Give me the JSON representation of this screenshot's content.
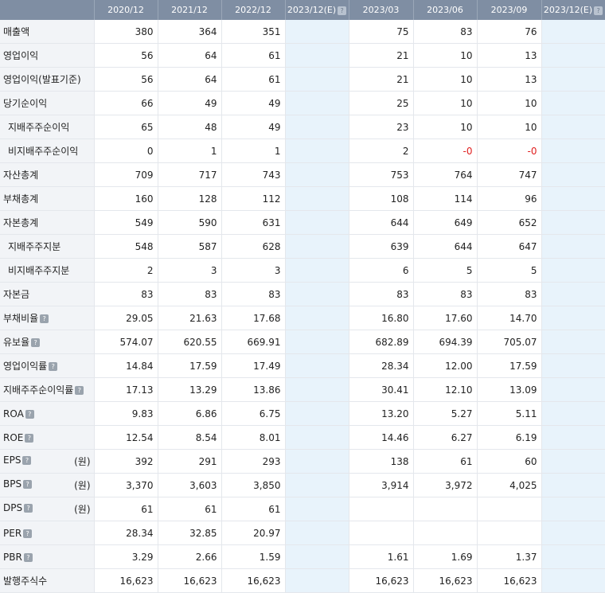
{
  "headers": [
    "",
    "2020/12",
    "2021/12",
    "2022/12",
    "2023/12(E)",
    "2023/03",
    "2023/06",
    "2023/09",
    "2023/12(E)"
  ],
  "help_icon": "?",
  "rows": [
    {
      "label": "매출액",
      "sub": false,
      "help": false,
      "unit": "",
      "values": [
        "380",
        "364",
        "351",
        "",
        "75",
        "83",
        "76",
        ""
      ]
    },
    {
      "label": "영업이익",
      "sub": false,
      "help": false,
      "unit": "",
      "values": [
        "56",
        "64",
        "61",
        "",
        "21",
        "10",
        "13",
        ""
      ]
    },
    {
      "label": "영업이익(발표기준)",
      "sub": false,
      "help": false,
      "unit": "",
      "values": [
        "56",
        "64",
        "61",
        "",
        "21",
        "10",
        "13",
        ""
      ]
    },
    {
      "label": "당기순이익",
      "sub": false,
      "help": false,
      "unit": "",
      "values": [
        "66",
        "49",
        "49",
        "",
        "25",
        "10",
        "10",
        ""
      ]
    },
    {
      "label": "지배주주순이익",
      "sub": true,
      "help": false,
      "unit": "",
      "values": [
        "65",
        "48",
        "49",
        "",
        "23",
        "10",
        "10",
        ""
      ]
    },
    {
      "label": "비지배주주순이익",
      "sub": true,
      "help": false,
      "unit": "",
      "values": [
        "0",
        "1",
        "1",
        "",
        "2",
        "-0",
        "-0",
        ""
      ]
    },
    {
      "label": "자산총계",
      "sub": false,
      "help": false,
      "unit": "",
      "values": [
        "709",
        "717",
        "743",
        "",
        "753",
        "764",
        "747",
        ""
      ]
    },
    {
      "label": "부채총계",
      "sub": false,
      "help": false,
      "unit": "",
      "values": [
        "160",
        "128",
        "112",
        "",
        "108",
        "114",
        "96",
        ""
      ]
    },
    {
      "label": "자본총계",
      "sub": false,
      "help": false,
      "unit": "",
      "values": [
        "549",
        "590",
        "631",
        "",
        "644",
        "649",
        "652",
        ""
      ]
    },
    {
      "label": "지배주주지분",
      "sub": true,
      "help": false,
      "unit": "",
      "values": [
        "548",
        "587",
        "628",
        "",
        "639",
        "644",
        "647",
        ""
      ]
    },
    {
      "label": "비지배주주지분",
      "sub": true,
      "help": false,
      "unit": "",
      "values": [
        "2",
        "3",
        "3",
        "",
        "6",
        "5",
        "5",
        ""
      ]
    },
    {
      "label": "자본금",
      "sub": false,
      "help": false,
      "unit": "",
      "values": [
        "83",
        "83",
        "83",
        "",
        "83",
        "83",
        "83",
        ""
      ]
    },
    {
      "label": "부채비율",
      "sub": false,
      "help": true,
      "unit": "",
      "values": [
        "29.05",
        "21.63",
        "17.68",
        "",
        "16.80",
        "17.60",
        "14.70",
        ""
      ]
    },
    {
      "label": "유보율",
      "sub": false,
      "help": true,
      "unit": "",
      "values": [
        "574.07",
        "620.55",
        "669.91",
        "",
        "682.89",
        "694.39",
        "705.07",
        ""
      ]
    },
    {
      "label": "영업이익률",
      "sub": false,
      "help": true,
      "unit": "",
      "values": [
        "14.84",
        "17.59",
        "17.49",
        "",
        "28.34",
        "12.00",
        "17.59",
        ""
      ]
    },
    {
      "label": "지배주주순이익률",
      "sub": false,
      "help": true,
      "unit": "",
      "values": [
        "17.13",
        "13.29",
        "13.86",
        "",
        "30.41",
        "12.10",
        "13.09",
        ""
      ]
    },
    {
      "label": "ROA",
      "sub": false,
      "help": true,
      "unit": "",
      "values": [
        "9.83",
        "6.86",
        "6.75",
        "",
        "13.20",
        "5.27",
        "5.11",
        ""
      ]
    },
    {
      "label": "ROE",
      "sub": false,
      "help": true,
      "unit": "",
      "values": [
        "12.54",
        "8.54",
        "8.01",
        "",
        "14.46",
        "6.27",
        "6.19",
        ""
      ]
    },
    {
      "label": "EPS",
      "sub": false,
      "help": true,
      "unit": "(원)",
      "values": [
        "392",
        "291",
        "293",
        "",
        "138",
        "61",
        "60",
        ""
      ]
    },
    {
      "label": "BPS",
      "sub": false,
      "help": true,
      "unit": "(원)",
      "values": [
        "3,370",
        "3,603",
        "3,850",
        "",
        "3,914",
        "3,972",
        "4,025",
        ""
      ]
    },
    {
      "label": "DPS",
      "sub": false,
      "help": true,
      "unit": "(원)",
      "values": [
        "61",
        "61",
        "61",
        "",
        "",
        "",
        "",
        ""
      ]
    },
    {
      "label": "PER",
      "sub": false,
      "help": true,
      "unit": "",
      "values": [
        "28.34",
        "32.85",
        "20.97",
        "",
        "",
        "",
        "",
        ""
      ]
    },
    {
      "label": "PBR",
      "sub": false,
      "help": true,
      "unit": "",
      "values": [
        "3.29",
        "2.66",
        "1.59",
        "",
        "1.61",
        "1.69",
        "1.37",
        ""
      ]
    },
    {
      "label": "발행주식수",
      "sub": false,
      "help": false,
      "unit": "",
      "values": [
        "16,623",
        "16,623",
        "16,623",
        "",
        "16,623",
        "16,623",
        "16,623",
        ""
      ]
    }
  ]
}
